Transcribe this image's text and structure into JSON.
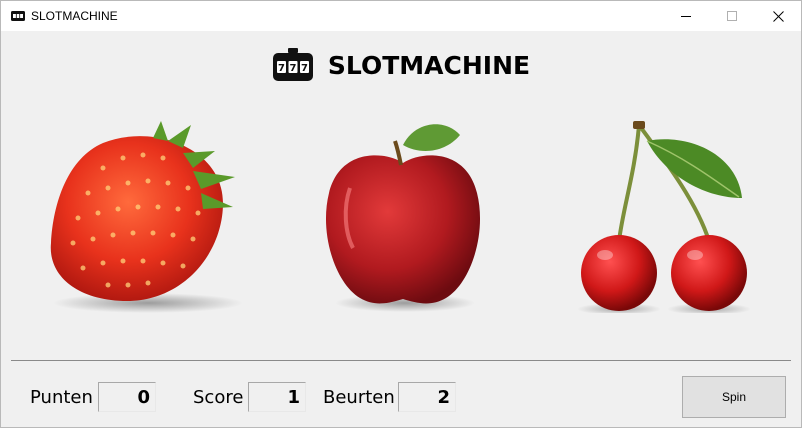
{
  "window": {
    "title": "SLOTMACHINE",
    "controls": [
      "minimize",
      "maximize",
      "close"
    ]
  },
  "header": {
    "title": "SLOTMACHINE",
    "icon": "slot-machine-777-icon"
  },
  "reels": [
    {
      "symbol": "strawberry"
    },
    {
      "symbol": "apple"
    },
    {
      "symbol": "cherries"
    }
  ],
  "stats": {
    "punten_label": "Punten",
    "punten_value": "0",
    "score_label": "Score",
    "score_value": "1",
    "beurten_label": "Beurten",
    "beurten_value": "2"
  },
  "spin_button": {
    "label": "Spin"
  }
}
